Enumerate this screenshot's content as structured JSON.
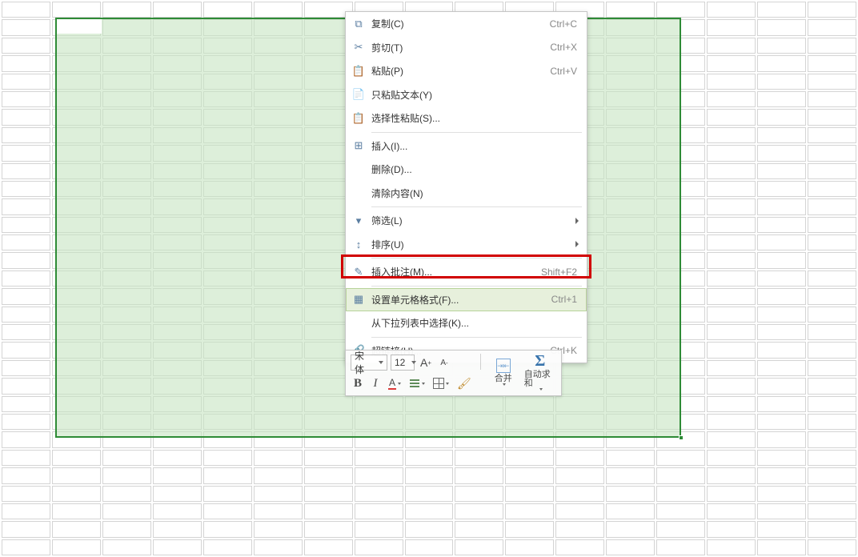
{
  "grid": {
    "selection_fill": "#dcefd5",
    "selection_border": "#2e8b36",
    "columns": 17,
    "rows": 31
  },
  "context_menu": {
    "groups": [
      [
        {
          "icon": "copy-icon",
          "label": "复制(C)",
          "shortcut": "Ctrl+C"
        },
        {
          "icon": "cut-icon",
          "label": "剪切(T)",
          "shortcut": "Ctrl+X"
        },
        {
          "icon": "paste-icon",
          "label": "粘贴(P)",
          "shortcut": "Ctrl+V"
        },
        {
          "icon": "paste-text-icon",
          "label": "只粘贴文本(Y)",
          "shortcut": ""
        },
        {
          "icon": "paste-special-icon",
          "label": "选择性粘贴(S)...",
          "shortcut": ""
        }
      ],
      [
        {
          "icon": "insert-icon",
          "label": "插入(I)...",
          "shortcut": ""
        },
        {
          "icon": "",
          "label": "删除(D)...",
          "shortcut": ""
        },
        {
          "icon": "",
          "label": "清除内容(N)",
          "shortcut": ""
        }
      ],
      [
        {
          "icon": "filter-icon",
          "label": "筛选(L)",
          "shortcut": "",
          "submenu": true
        },
        {
          "icon": "sort-icon",
          "label": "排序(U)",
          "shortcut": "",
          "submenu": true
        }
      ],
      [
        {
          "icon": "comment-icon",
          "label": "插入批注(M)...",
          "shortcut": "Shift+F2"
        }
      ],
      [
        {
          "icon": "format-cells-icon",
          "label": "设置单元格格式(F)...",
          "shortcut": "Ctrl+1",
          "hovered": true
        },
        {
          "icon": "",
          "label": "从下拉列表中选择(K)...",
          "shortcut": ""
        }
      ],
      [
        {
          "icon": "hyperlink-icon",
          "label": "超链接(H)...",
          "shortcut": "Ctrl+K"
        }
      ]
    ]
  },
  "mini_toolbar": {
    "font_name": "宋体",
    "font_size": "12",
    "increase_font": "A",
    "decrease_font": "A",
    "bold": "B",
    "italic": "I",
    "merge_label": "合并",
    "autosum_label": "自动求和"
  }
}
